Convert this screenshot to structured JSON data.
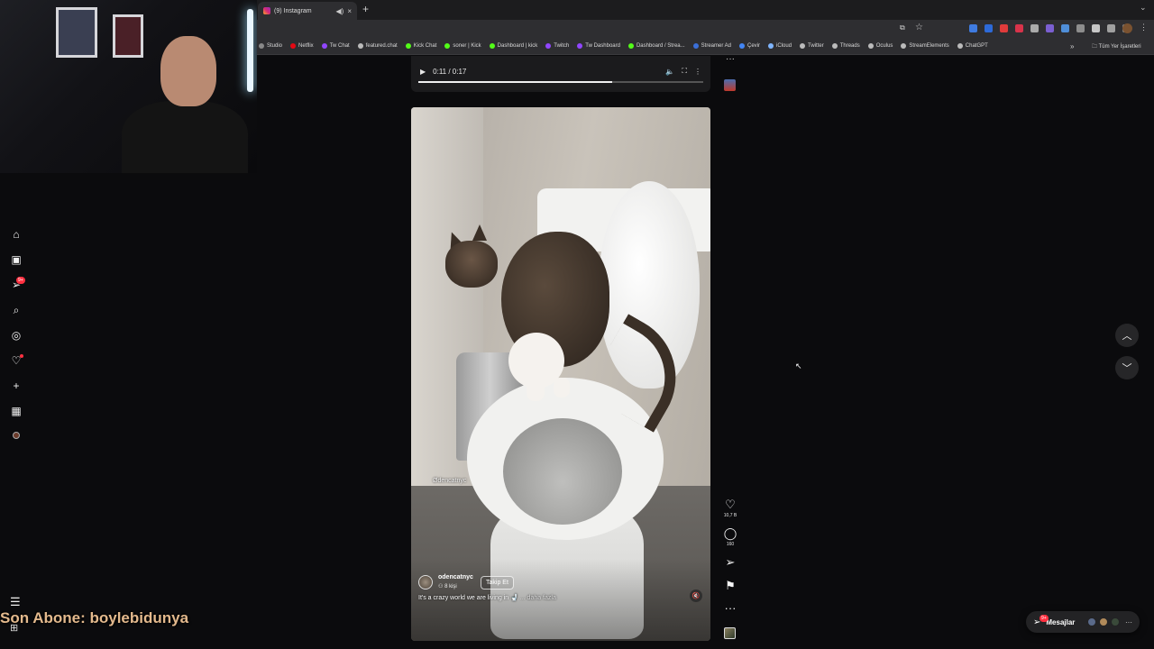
{
  "browser": {
    "tab_title": "(9) Instagram",
    "new_tab": "+",
    "tab_close": "×",
    "tab_sound": "◀)",
    "bookmarks": [
      {
        "label": "Studio",
        "color": "#888888"
      },
      {
        "label": "Netflix",
        "color": "#e50914"
      },
      {
        "label": "Tw Chat",
        "color": "#9146ff"
      },
      {
        "label": "featured.chat",
        "color": "#bbbbbb"
      },
      {
        "label": "Kick Chat",
        "color": "#53fc18"
      },
      {
        "label": "soner | Kick",
        "color": "#53fc18"
      },
      {
        "label": "Dashboard | kick",
        "color": "#53fc18"
      },
      {
        "label": "Twitch",
        "color": "#9146ff"
      },
      {
        "label": "Tw Dashboard",
        "color": "#9146ff"
      },
      {
        "label": "Dashboard / Strea...",
        "color": "#53fc18"
      },
      {
        "label": "Streamer Ad",
        "color": "#3b6fd8"
      },
      {
        "label": "Çevir",
        "color": "#4285f4"
      },
      {
        "label": "iCloud",
        "color": "#7fb5ff"
      },
      {
        "label": "Twitter",
        "color": "#bbbbbb"
      },
      {
        "label": "Threads",
        "color": "#bbbbbb"
      },
      {
        "label": "Oculus",
        "color": "#bbbbbb"
      },
      {
        "label": "StreamElements",
        "color": "#bbbbbb"
      },
      {
        "label": "ChatGPT",
        "color": "#bbbbbb"
      }
    ],
    "bookmarks_more": "»",
    "all_bookmarks": "Tüm Yer İşaretleri"
  },
  "overlay": {
    "last_subscriber": "Son Abone: boylebidunya"
  },
  "sidebar": {
    "notification_badge": "9+"
  },
  "previous_video": {
    "time": "0:11 / 0:17",
    "progress": 0.68
  },
  "reel": {
    "watermark": "Ødencatnyc",
    "creator": "odencatnyc",
    "audience": "8 kişi",
    "follow_label": "Takip Et",
    "caption": "It's a crazy world we are living in 🚽",
    "caption_more": "... daha fazla"
  },
  "actions": {
    "likes": "10,7 B",
    "comments": "160"
  },
  "messages": {
    "label": "Mesajlar",
    "badge": "9+"
  },
  "colors": {
    "accent_badge": "#ff3040",
    "background": "#0b0b0d",
    "overlay_text": "#e3b98d"
  }
}
